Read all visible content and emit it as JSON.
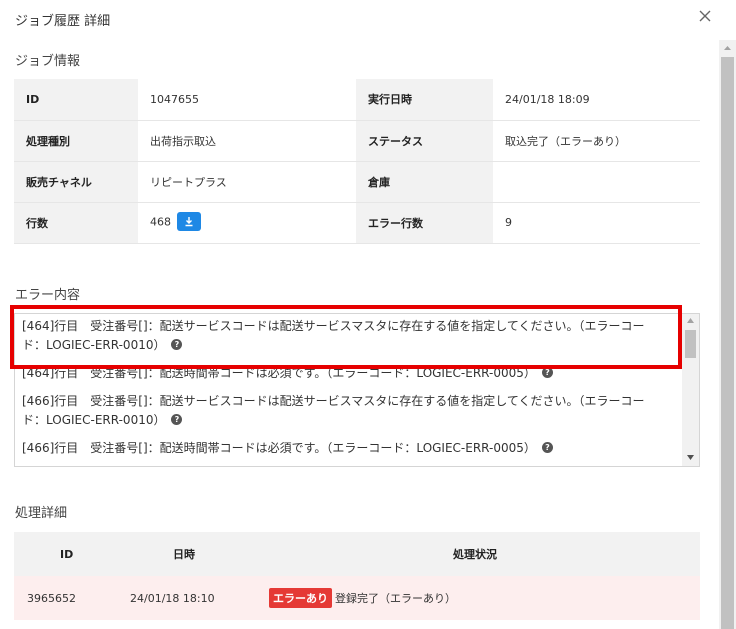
{
  "dialog": {
    "title": "ジョブ履歴 詳細",
    "close_icon": "close-icon"
  },
  "job_info": {
    "heading": "ジョブ情報",
    "rows": [
      {
        "k1": "ID",
        "v1": "1047655",
        "k2": "実行日時",
        "v2": "24/01/18 18:09"
      },
      {
        "k1": "処理種別",
        "v1": "出荷指示取込",
        "k2": "ステータス",
        "v2": "取込完了（エラーあり）"
      },
      {
        "k1": "販売チャネル",
        "v1": "リピートプラス",
        "k2": "倉庫",
        "v2": ""
      },
      {
        "k1": "行数",
        "v1": "468",
        "k2": "エラー行数",
        "v2": "9"
      }
    ],
    "download_icon": "download-icon"
  },
  "errors": {
    "heading": "エラー内容",
    "items": [
      {
        "line1": "[464]行目　受注番号[]：配送サービスコードは配送サービスマスタに存在する値を指定してください。（エラーコー",
        "line2": "ド：LOGIEC-ERR-0010）"
      },
      {
        "line1": "[464]行目　受注番号[]：配送時間帯コードは必須です。（エラーコード：LOGIEC-ERR-0005）",
        "line2": ""
      },
      {
        "line1": "[466]行目　受注番号[]：配送サービスコードは配送サービスマスタに存在する値を指定してください。（エラーコー",
        "line2": "ド：LOGIEC-ERR-0010）"
      },
      {
        "line1": "[466]行目　受注番号[]：配送時間帯コードは必須です。（エラーコード：LOGIEC-ERR-0005）",
        "line2": ""
      }
    ],
    "help_glyph": "?"
  },
  "process": {
    "heading": "処理詳細",
    "columns": [
      "ID",
      "日時",
      "処理状況"
    ],
    "rows": [
      {
        "id": "3965652",
        "datetime": "24/01/18 18:10",
        "badge": "エラーあり",
        "status": "登録完了（エラーあり）"
      }
    ]
  },
  "colors": {
    "highlight": "#e60000",
    "badge": "#e53935",
    "download": "#1e88e5",
    "error_row": "#fdeeee"
  }
}
